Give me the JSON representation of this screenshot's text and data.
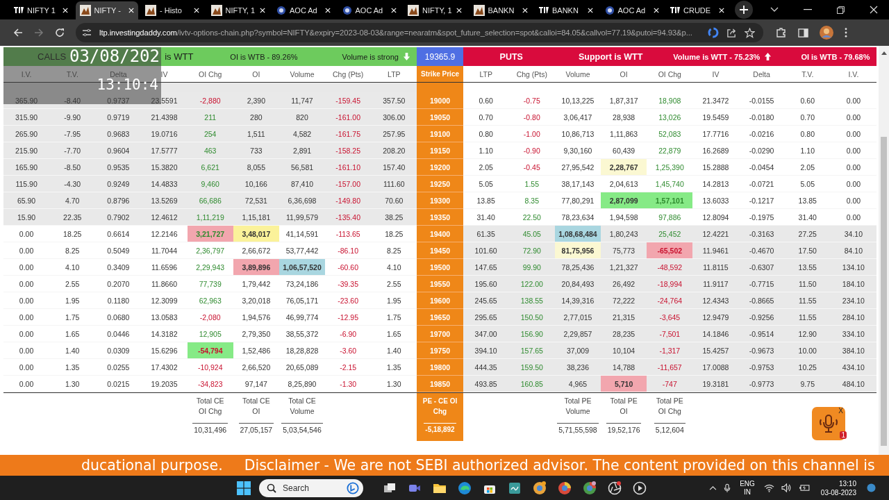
{
  "tabs": [
    {
      "title": "NIFTY 1",
      "kind": "tv",
      "selected": false
    },
    {
      "title": "NIFTY -",
      "kind": "image",
      "selected": true
    },
    {
      "title": "- Histo",
      "kind": "image",
      "selected": false
    },
    {
      "title": "NIFTY, 1",
      "kind": "image",
      "selected": false
    },
    {
      "title": "AOC Ad",
      "kind": "emblem",
      "selected": false
    },
    {
      "title": "AOC Ad",
      "kind": "emblem",
      "selected": false
    },
    {
      "title": "NIFTY, 1",
      "kind": "image",
      "selected": false
    },
    {
      "title": "BANKN",
      "kind": "image",
      "selected": false
    },
    {
      "title": "BANKN",
      "kind": "tv",
      "selected": false
    },
    {
      "title": "AOC Ad",
      "kind": "emblem",
      "selected": false
    },
    {
      "title": "CRUDE",
      "kind": "tv",
      "selected": false
    }
  ],
  "address": {
    "host": "ltp.investingdaddy.com",
    "path": "/ivtv-options-chain.php?symbol=NIFTY&expiry=2023-08-03&range=nearatm&spot_future_selection=spot&calloi=84.05&callvol=77.19&putoi=94.93&p..."
  },
  "summary": {
    "calls_label": "CALLS",
    "resistance": "is WTT",
    "call_oi": "OI is WTB - 89.26%",
    "call_volume": "Volume is strong",
    "call_volume_up": false,
    "spot": "19365.9",
    "puts_label": "PUTS",
    "support": "Support is WTT",
    "put_volume": "Volume is WTT - 75.23%",
    "put_volume_up": true,
    "put_oi": "OI is WTB - 79.68%"
  },
  "overlay": {
    "date": "03/08/202",
    "time": "13:10:4"
  },
  "columns": {
    "calls": [
      "I.V.",
      "T.V.",
      "Delta",
      "IV",
      "OI Chg",
      "OI",
      "Volume",
      "Chg (Pts)",
      "LTP"
    ],
    "strike": "Strike Price",
    "puts": [
      "LTP",
      "Chg (Pts)",
      "Volume",
      "OI",
      "OI Chg",
      "IV",
      "Delta",
      "T.V.",
      "I.V."
    ]
  },
  "rows": [
    {
      "strike": "19000",
      "call_itm": true,
      "call_oi_chg_up": false,
      "call_chg_up": false,
      "put_chg_up": false,
      "put_oi_chg_up": true,
      "calls": [
        "365.90",
        "-8.40",
        "0.9737",
        "23.5591",
        "-2,880",
        "2,390",
        "11,747",
        "-159.45",
        "357.50"
      ],
      "puts": [
        "0.60",
        "-0.75",
        "10,13,225",
        "1,87,317",
        "18,908",
        "21.3472",
        "-0.0155",
        "0.60",
        "0.00"
      ]
    },
    {
      "strike": "19050",
      "call_itm": true,
      "call_oi_chg_up": true,
      "call_chg_up": false,
      "put_chg_up": false,
      "put_oi_chg_up": true,
      "calls": [
        "315.90",
        "-9.90",
        "0.9719",
        "21.4398",
        "211",
        "280",
        "820",
        "-161.00",
        "306.00"
      ],
      "puts": [
        "0.70",
        "-0.80",
        "3,06,417",
        "28,938",
        "13,026",
        "19.5459",
        "-0.0180",
        "0.70",
        "0.00"
      ]
    },
    {
      "strike": "19100",
      "call_itm": true,
      "call_oi_chg_up": true,
      "call_chg_up": false,
      "put_chg_up": false,
      "put_oi_chg_up": true,
      "calls": [
        "265.90",
        "-7.95",
        "0.9683",
        "19.0716",
        "254",
        "1,511",
        "4,582",
        "-161.75",
        "257.95"
      ],
      "puts": [
        "0.80",
        "-1.00",
        "10,86,713",
        "1,11,863",
        "52,083",
        "17.7716",
        "-0.0216",
        "0.80",
        "0.00"
      ]
    },
    {
      "strike": "19150",
      "call_itm": true,
      "call_oi_chg_up": true,
      "call_chg_up": false,
      "put_chg_up": false,
      "put_oi_chg_up": true,
      "calls": [
        "215.90",
        "-7.70",
        "0.9604",
        "17.5777",
        "463",
        "733",
        "2,891",
        "-158.25",
        "208.20"
      ],
      "puts": [
        "1.10",
        "-0.90",
        "9,30,160",
        "60,439",
        "22,879",
        "16.2689",
        "-0.0290",
        "1.10",
        "0.00"
      ]
    },
    {
      "strike": "19200",
      "call_itm": true,
      "call_oi_chg_up": true,
      "call_chg_up": false,
      "put_chg_up": false,
      "put_oi_chg_up": true,
      "calls": [
        "165.90",
        "-8.50",
        "0.9535",
        "15.3820",
        "6,621",
        "8,055",
        "56,581",
        "-161.10",
        "157.40"
      ],
      "puts": [
        "2.05",
        "-0.45",
        "27,95,542",
        {
          "value": "2,28,767",
          "color": "#fbf8d2"
        },
        "1,25,390",
        "15.2888",
        "-0.0454",
        "2.05",
        "0.00"
      ]
    },
    {
      "strike": "19250",
      "call_itm": true,
      "call_oi_chg_up": true,
      "call_chg_up": false,
      "put_chg_up": true,
      "put_oi_chg_up": true,
      "calls": [
        "115.90",
        "-4.30",
        "0.9249",
        "14.4833",
        "9,460",
        "10,166",
        "87,410",
        "-157.00",
        "111.60"
      ],
      "puts": [
        "5.05",
        "1.55",
        "38,17,143",
        "2,04,613",
        "1,45,740",
        "14.2813",
        "-0.0721",
        "5.05",
        "0.00"
      ]
    },
    {
      "strike": "19300",
      "call_itm": true,
      "call_oi_chg_up": true,
      "call_chg_up": false,
      "put_chg_up": true,
      "put_oi_chg_up": true,
      "calls": [
        "65.90",
        "4.70",
        "0.8796",
        "13.5269",
        "66,686",
        "72,531",
        "6,36,698",
        "-149.80",
        "70.60"
      ],
      "puts": [
        "13.85",
        "8.35",
        "77,80,291",
        {
          "value": "2,87,099",
          "color": "#86ea86"
        },
        {
          "value": "1,57,101",
          "color": "#86ea86"
        },
        "13.6033",
        "-0.1217",
        "13.85",
        "0.00"
      ]
    },
    {
      "strike": "19350",
      "call_itm": true,
      "call_oi_chg_up": true,
      "call_chg_up": false,
      "put_chg_up": true,
      "put_oi_chg_up": true,
      "calls": [
        "15.90",
        "22.35",
        "0.7902",
        "12.4612",
        "1,11,219",
        "1,15,181",
        "11,99,579",
        "-135.40",
        "38.25"
      ],
      "puts": [
        "31.40",
        "22.50",
        "78,23,634",
        "1,94,598",
        "97,886",
        "12.8094",
        "-0.1975",
        "31.40",
        "0.00"
      ]
    },
    {
      "strike": "19400",
      "call_itm": false,
      "call_oi_chg_up": true,
      "call_chg_up": false,
      "put_chg_up": true,
      "put_oi_chg_up": true,
      "calls": [
        "0.00",
        "18.25",
        "0.6614",
        "12.2146",
        {
          "value": "3,21,727",
          "color": "#f2a6ae"
        },
        {
          "value": "3,48,017",
          "color": "#fbf29a"
        },
        "41,14,591",
        "-113.65",
        "18.25"
      ],
      "puts": [
        "61.35",
        "45.05",
        {
          "value": "1,08,68,484",
          "color": "#a9d6e0"
        },
        "1,80,243",
        "25,452",
        "12.4221",
        "-0.3163",
        "27.25",
        "34.10"
      ]
    },
    {
      "strike": "19450",
      "call_itm": false,
      "call_oi_chg_up": true,
      "call_chg_up": false,
      "put_chg_up": true,
      "put_oi_chg_up": false,
      "calls": [
        "0.00",
        "8.25",
        "0.5049",
        "11.7044",
        "2,36,797",
        "2,66,672",
        "53,77,442",
        "-86.10",
        "8.25"
      ],
      "puts": [
        "101.60",
        "72.90",
        {
          "value": "81,75,956",
          "color": "#fbf8d2"
        },
        "75,773",
        {
          "value": "-65,502",
          "color": "#f2a6ae"
        },
        "11.9461",
        "-0.4670",
        "17.50",
        "84.10"
      ]
    },
    {
      "strike": "19500",
      "call_itm": false,
      "call_oi_chg_up": true,
      "call_chg_up": false,
      "put_chg_up": true,
      "put_oi_chg_up": false,
      "calls": [
        "0.00",
        "4.10",
        "0.3409",
        "11.6596",
        "2,29,943",
        {
          "value": "3,89,896",
          "color": "#f2a6ae"
        },
        {
          "value": "1,06,57,520",
          "color": "#a9d6e0"
        },
        "-60.60",
        "4.10"
      ],
      "puts": [
        "147.65",
        "99.90",
        "78,25,436",
        "1,21,327",
        "-48,592",
        "11.8115",
        "-0.6307",
        "13.55",
        "134.10"
      ]
    },
    {
      "strike": "19550",
      "call_itm": false,
      "call_oi_chg_up": true,
      "call_chg_up": false,
      "put_chg_up": true,
      "put_oi_chg_up": false,
      "calls": [
        "0.00",
        "2.55",
        "0.2070",
        "11.8660",
        "77,739",
        "1,79,442",
        "73,24,186",
        "-39.35",
        "2.55"
      ],
      "puts": [
        "195.60",
        "122.00",
        "20,84,493",
        "26,492",
        "-18,994",
        "11.9117",
        "-0.7715",
        "11.50",
        "184.10"
      ]
    },
    {
      "strike": "19600",
      "call_itm": false,
      "call_oi_chg_up": true,
      "call_chg_up": false,
      "put_chg_up": true,
      "put_oi_chg_up": false,
      "calls": [
        "0.00",
        "1.95",
        "0.1180",
        "12.3099",
        "62,963",
        "3,20,018",
        "76,05,171",
        "-23.60",
        "1.95"
      ],
      "puts": [
        "245.65",
        "138.55",
        "14,39,316",
        "72,222",
        "-24,764",
        "12.4343",
        "-0.8665",
        "11.55",
        "234.10"
      ]
    },
    {
      "strike": "19650",
      "call_itm": false,
      "call_oi_chg_up": false,
      "call_chg_up": false,
      "put_chg_up": true,
      "put_oi_chg_up": false,
      "calls": [
        "0.00",
        "1.75",
        "0.0680",
        "13.0583",
        "-2,080",
        "1,94,576",
        "46,99,774",
        "-12.95",
        "1.75"
      ],
      "puts": [
        "295.65",
        "150.50",
        "2,77,015",
        "21,315",
        "-3,645",
        "12.9479",
        "-0.9256",
        "11.55",
        "284.10"
      ]
    },
    {
      "strike": "19700",
      "call_itm": false,
      "call_oi_chg_up": true,
      "call_chg_up": false,
      "put_chg_up": true,
      "put_oi_chg_up": false,
      "calls": [
        "0.00",
        "1.65",
        "0.0446",
        "14.3182",
        "12,905",
        "2,79,350",
        "38,55,372",
        "-6.90",
        "1.65"
      ],
      "puts": [
        "347.00",
        "156.90",
        "2,29,857",
        "28,235",
        "-7,501",
        "14.1846",
        "-0.9514",
        "12.90",
        "334.10"
      ]
    },
    {
      "strike": "19750",
      "call_itm": false,
      "call_oi_chg_up": false,
      "call_chg_up": false,
      "put_chg_up": true,
      "put_oi_chg_up": false,
      "calls": [
        "0.00",
        "1.40",
        "0.0309",
        "15.6296",
        {
          "value": "-54,794",
          "color": "#86ea86"
        },
        "1,52,486",
        "18,28,828",
        "-3.60",
        "1.40"
      ],
      "puts": [
        "394.10",
        "157.65",
        "37,009",
        "10,104",
        "-1,317",
        "15.4257",
        "-0.9673",
        "10.00",
        "384.10"
      ]
    },
    {
      "strike": "19800",
      "call_itm": false,
      "call_oi_chg_up": false,
      "call_chg_up": false,
      "put_chg_up": true,
      "put_oi_chg_up": false,
      "calls": [
        "0.00",
        "1.35",
        "0.0255",
        "17.4302",
        "-10,924",
        "2,66,520",
        "20,65,089",
        "-2.15",
        "1.35"
      ],
      "puts": [
        "444.35",
        "159.50",
        "38,236",
        "14,788",
        "-11,657",
        "17.0088",
        "-0.9753",
        "10.25",
        "434.10"
      ]
    },
    {
      "strike": "19850",
      "call_itm": false,
      "call_oi_chg_up": false,
      "call_chg_up": false,
      "put_chg_up": true,
      "put_oi_chg_up": false,
      "calls": [
        "0.00",
        "1.30",
        "0.0215",
        "19.2035",
        "-34,823",
        "97,147",
        "8,25,890",
        "-1.30",
        "1.30"
      ],
      "puts": [
        "493.85",
        "160.85",
        "4,965",
        {
          "value": "5,710",
          "color": "#f2a6ae"
        },
        "-747",
        "19.3181",
        "-0.9773",
        "9.75",
        "484.10"
      ]
    }
  ],
  "totals": {
    "calls": [
      {
        "label": "Total CE OI Chg",
        "value": "10,31,496"
      },
      {
        "label": "Total CE OI",
        "value": "27,05,157"
      },
      {
        "label": "Total CE Volume",
        "value": "5,03,54,546"
      }
    ],
    "net": {
      "label": "PE - CE OI Chg",
      "value": "-5,18,892"
    },
    "puts": [
      {
        "label": "Total PE Volume",
        "value": "5,71,55,598"
      },
      {
        "label": "Total PE OI",
        "value": "19,52,176"
      },
      {
        "label": "Total PE OI Chg",
        "value": "5,12,604"
      }
    ]
  },
  "mic_widget": {
    "close": "X",
    "badge": "1"
  },
  "ticker": [
    "ducational purpose.",
    "Disclaimer - We are not SEBI authorized advisor. The content provided on this channel is"
  ],
  "taskbar": {
    "search": "Search",
    "language": "ENG",
    "region": "IN",
    "time": "13:10",
    "date": "03-08-2023"
  }
}
